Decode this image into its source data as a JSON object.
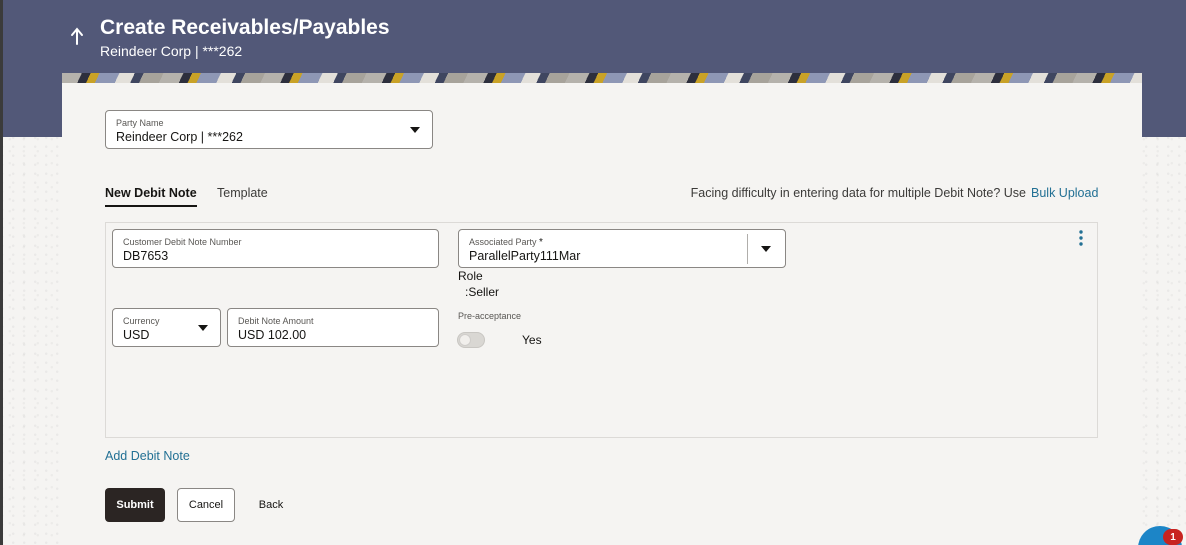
{
  "header": {
    "title": "Create Receivables/Payables",
    "subtitle": "Reindeer Corp | ***262"
  },
  "party": {
    "label": "Party Name",
    "value": "Reindeer Corp | ***262"
  },
  "tabs": [
    {
      "label": "New Debit Note",
      "active": true
    },
    {
      "label": "Template",
      "active": false
    }
  ],
  "bulk_upload": {
    "text": "Facing difficulty in entering data for multiple Debit Note? Use",
    "link": "Bulk Upload"
  },
  "debit_note": {
    "customer_number": {
      "label": "Customer Debit Note Number",
      "value": "DB7653"
    },
    "associated_party": {
      "label": "Associated Party",
      "required_mark": "*",
      "value": "ParallelParty111Mar"
    },
    "role": {
      "label": "Role",
      "value": ":Seller"
    },
    "currency": {
      "label": "Currency",
      "value": "USD"
    },
    "amount": {
      "label": "Debit Note Amount",
      "value": "USD 102.00"
    },
    "pre_acceptance": {
      "label": "Pre-acceptance",
      "value_label": "Yes",
      "enabled": true
    }
  },
  "add_debit_note": "Add Debit Note",
  "buttons": {
    "submit": "Submit",
    "cancel": "Cancel",
    "back": "Back"
  },
  "chat": {
    "badge_count": "1"
  },
  "colors": {
    "header_bg": "#525878",
    "link": "#227094",
    "primary_button": "#2b2523",
    "badge": "#c82320"
  }
}
